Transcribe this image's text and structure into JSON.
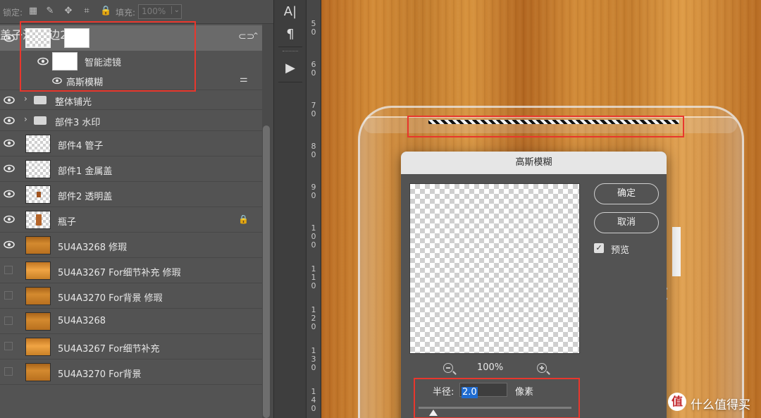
{
  "lock_bar": {
    "lock_label": "锁定:",
    "fill_label": "填充:",
    "fill_value": "100%"
  },
  "layers": {
    "group": {
      "name": "盖子沿 描边2像素"
    },
    "smart_filters_label": "智能滤镜",
    "gaussian_blur_label": "高斯模糊",
    "rows": [
      {
        "name": "整体铺光",
        "kind": "folder",
        "visible": true
      },
      {
        "name": "部件3 水印",
        "kind": "folder",
        "visible": true
      },
      {
        "name": "部件4 管子",
        "kind": "layer",
        "visible": true
      },
      {
        "name": "部件1 金属盖",
        "kind": "layer",
        "visible": true
      },
      {
        "name": "部件2 透明盖",
        "kind": "layer",
        "visible": true
      },
      {
        "name": "瓶子",
        "kind": "layer",
        "visible": true,
        "locked": true
      },
      {
        "name": "5U4A3268 修瑕",
        "kind": "photo",
        "visible": true
      },
      {
        "name": "5U4A3267 For细节补充 修瑕",
        "kind": "photo",
        "visible": false
      },
      {
        "name": "5U4A3270 For背景 修瑕",
        "kind": "photo",
        "visible": false
      },
      {
        "name": "5U4A3268",
        "kind": "photo",
        "visible": false
      },
      {
        "name": "5U4A3267 For细节补充",
        "kind": "photo",
        "visible": false
      },
      {
        "name": "5U4A3270 For背景",
        "kind": "photo",
        "visible": false
      }
    ]
  },
  "tools": {
    "char_label": "A|",
    "para_label": "¶",
    "play_label": "▶"
  },
  "ruler": {
    "marks": [
      "5 0",
      "6 0",
      "7 0",
      "8 0",
      "9 0",
      "1 0 0",
      "1 1 0",
      "1 2 0",
      "1 3 0",
      "1 4 0"
    ]
  },
  "dialog": {
    "title": "高斯模糊",
    "ok_label": "确定",
    "cancel_label": "取消",
    "preview_label": "预览",
    "preview_checked": true,
    "zoom_value": "100%",
    "radius_label": "半径:",
    "radius_value": "2.0",
    "unit_label": "像素"
  },
  "watermark": {
    "badge": "值",
    "text": "什么值得买"
  },
  "colors": {
    "highlight_red": "#e8372d",
    "selection_blue": "#1f6cd1",
    "panel_bg": "#535353"
  }
}
